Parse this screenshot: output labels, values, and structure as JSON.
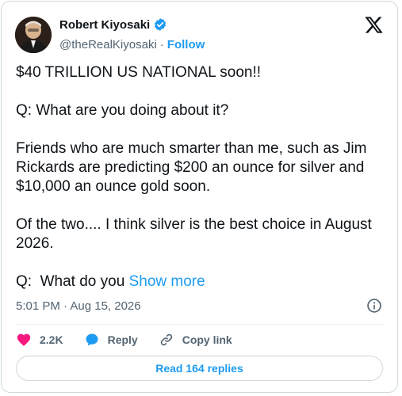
{
  "author": {
    "name": "Robert Kiyosaki",
    "handle": "@theRealKiyosaki",
    "separator": "·",
    "follow_label": "Follow"
  },
  "tweet": {
    "paragraphs": [
      "$40 TRILLION US NATIONAL soon!!",
      "Q: What are you doing about it?",
      "Friends who are much smarter than me, such as Jim Rickards are predicting $200 an ounce for silver and $10,000 an ounce gold soon.",
      "Of the two.... I think silver is the best choice in August 2026."
    ],
    "last_paragraph": "Q:  What do you ",
    "show_more_label": "Show more"
  },
  "meta": {
    "timestamp": "5:01 PM · Aug 15, 2026"
  },
  "actions": {
    "like_count": "2.2K",
    "reply_label": "Reply",
    "copy_link_label": "Copy link"
  },
  "read_replies_label": "Read 164 replies",
  "colors": {
    "accent": "#1d9bf0",
    "like": "#f91880",
    "text": "#0f1419",
    "muted": "#536471"
  },
  "icons": [
    "verified-badge-icon",
    "x-logo-icon",
    "info-icon",
    "heart-icon",
    "reply-bubble-icon",
    "link-icon"
  ]
}
